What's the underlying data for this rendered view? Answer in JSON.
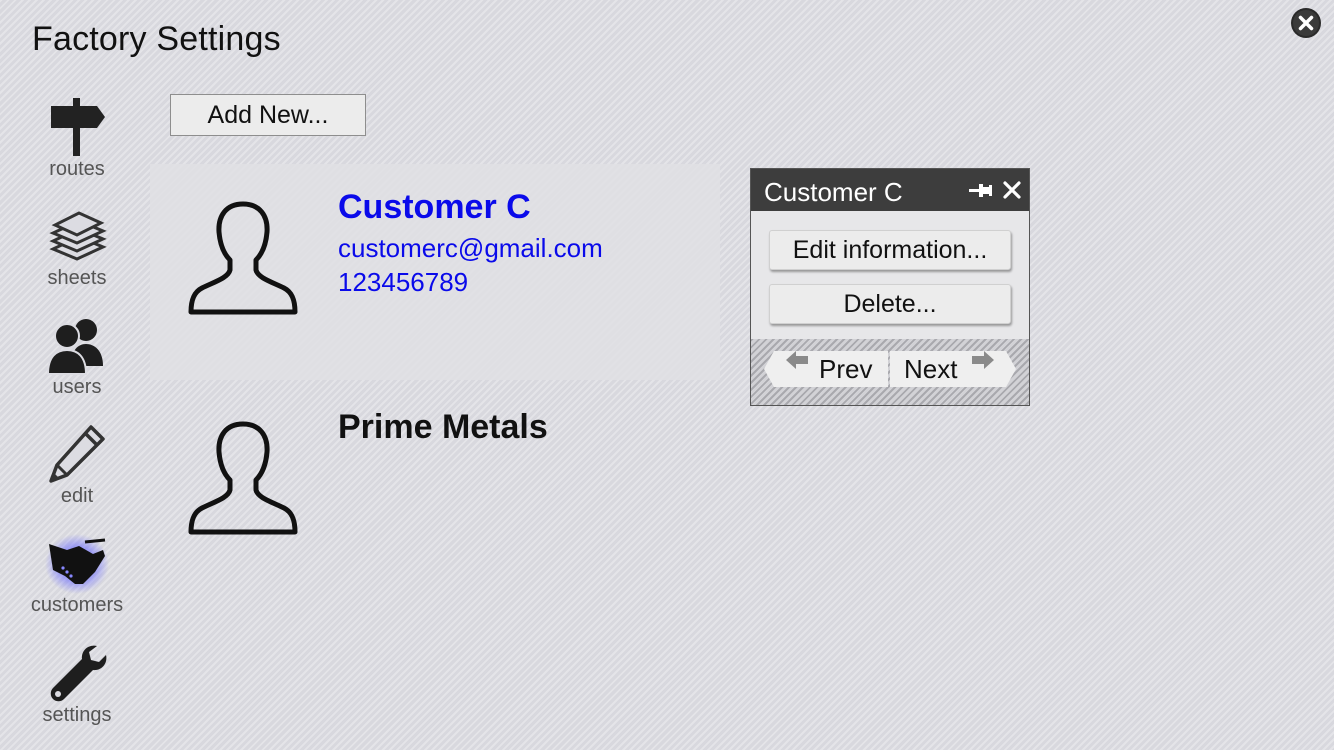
{
  "window": {
    "title": "Factory Settings",
    "close_icon": "close-circle-icon"
  },
  "sidebar": {
    "items": [
      {
        "label": "routes",
        "icon": "signpost-icon",
        "active": false
      },
      {
        "label": "sheets",
        "icon": "stacked-sheets-icon",
        "active": false
      },
      {
        "label": "users",
        "icon": "users-icon",
        "active": false
      },
      {
        "label": "edit",
        "icon": "pencil-icon",
        "active": false
      },
      {
        "label": "customers",
        "icon": "handshake-icon",
        "active": true
      },
      {
        "label": "settings",
        "icon": "wrench-icon",
        "active": false
      }
    ]
  },
  "toolbar": {
    "add_label": "Add New..."
  },
  "customers": [
    {
      "name": "Customer C",
      "email": "customerc@gmail.com",
      "phone": "123456789",
      "selected": true
    },
    {
      "name": "Prime Metals",
      "selected": false
    }
  ],
  "popup": {
    "title": "Customer C",
    "edit_label": "Edit information...",
    "delete_label": "Delete...",
    "prev_label": "Prev",
    "next_label": "Next",
    "pin_icon": "pin-icon",
    "close_icon": "close-icon"
  },
  "colors": {
    "link": "#0a0aea",
    "active_glow": "#6a6aff",
    "header_dark": "#3d3d3d"
  }
}
